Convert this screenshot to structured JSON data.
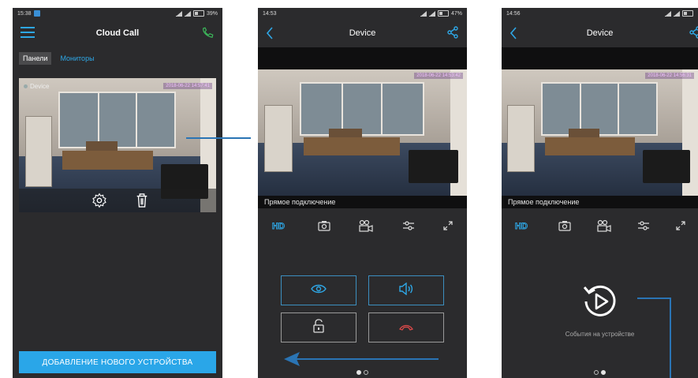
{
  "colors": {
    "accent": "#2aa6e8",
    "bg": "#2b2b2d",
    "end_call": "#e04a4a",
    "call_green": "#3cb65a"
  },
  "screen1": {
    "time": "15:38",
    "battery": "39%",
    "title": "Cloud Call",
    "tabs": [
      {
        "label": "Панели"
      },
      {
        "label": "Мониторы"
      }
    ],
    "card": {
      "name": "Device",
      "timestamp": "2018-06-22 14:57:41"
    },
    "add_button": "ДОБАВЛЕНИЕ НОВОГО УСТРОЙСТВА"
  },
  "screen2": {
    "time": "14:53",
    "battery": "47%",
    "title": "Device",
    "timestamp": "2018-06-22 14:53:42",
    "live_label": "Прямое подключение",
    "controls": [
      "hd-icon",
      "snapshot-icon",
      "record-icon",
      "settings-slider-icon",
      "fullscreen-icon"
    ],
    "buttons": [
      "view-icon",
      "speaker-icon",
      "unlock-icon",
      "end-call-icon"
    ],
    "page": 1
  },
  "screen3": {
    "time": "14:56",
    "title": "Device",
    "timestamp": "2018-06-22 14:56:31",
    "live_label": "Прямое подключение",
    "events_label": "События на устройстве",
    "page": 2
  }
}
